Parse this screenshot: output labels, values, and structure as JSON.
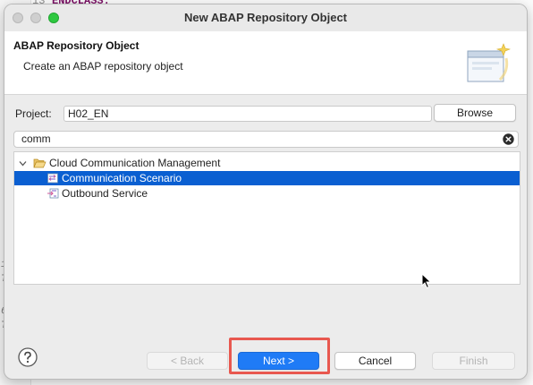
{
  "background": {
    "line_number": "13",
    "code": "ENDCLASS.",
    "left_fragments": [
      "1",
      "T",
      "6",
      "T"
    ]
  },
  "dialog": {
    "title": "New ABAP Repository Object",
    "header": {
      "title": "ABAP Repository Object",
      "subtitle": "Create an ABAP repository object"
    },
    "project": {
      "label": "Project:",
      "value": "H02_EN",
      "browse_label": "Browse"
    },
    "filter": {
      "value": "comm"
    },
    "tree": [
      {
        "label": "Cloud Communication Management",
        "icon": "folder-open-icon",
        "expanded": true,
        "level": 0
      },
      {
        "label": "Communication Scenario",
        "icon": "communication-scenario-icon",
        "level": 1,
        "selected": true
      },
      {
        "label": "Outbound Service",
        "icon": "outbound-service-icon",
        "level": 1
      }
    ],
    "buttons": {
      "back": "< Back",
      "next": "Next >",
      "cancel": "Cancel",
      "finish": "Finish"
    }
  },
  "colors": {
    "selection": "#0a5fd1",
    "primary_button": "#1f7bf6",
    "highlight_box": "#e8584f"
  }
}
